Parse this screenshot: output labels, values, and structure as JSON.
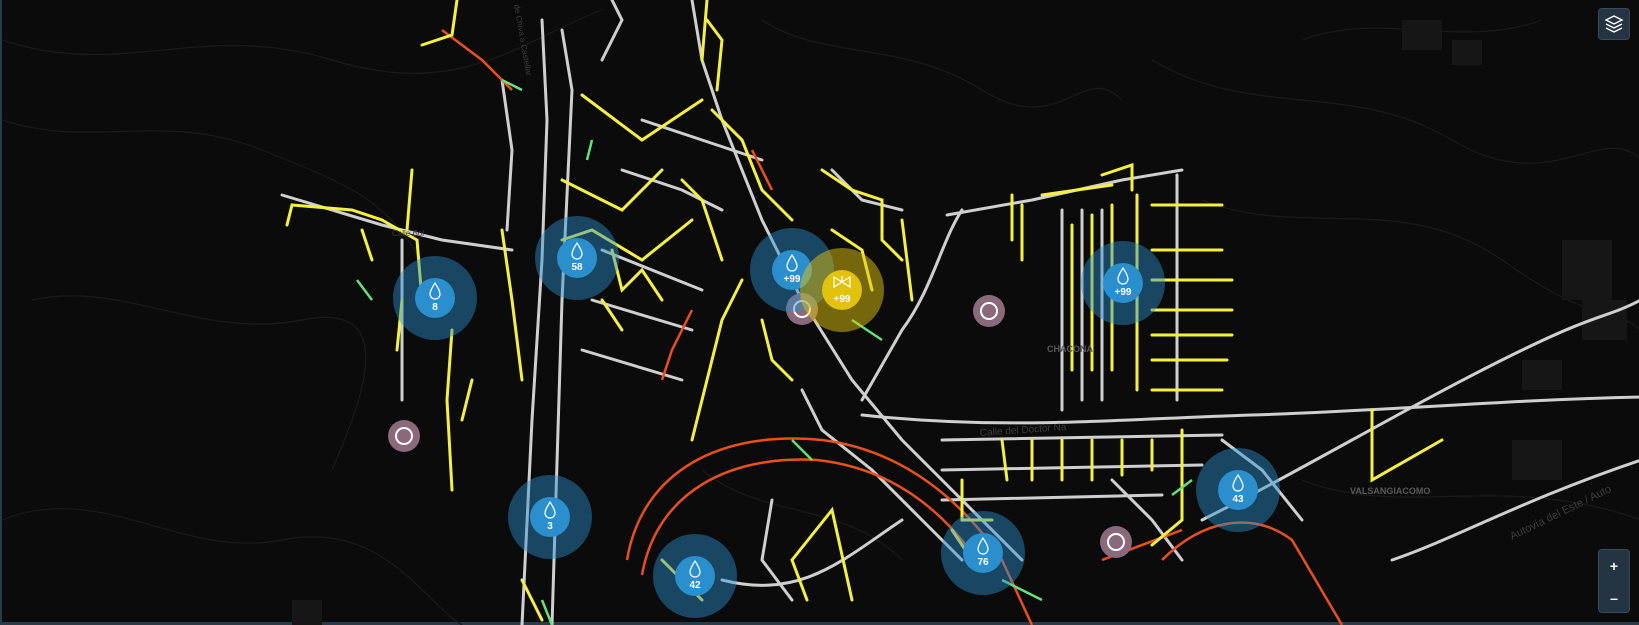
{
  "map": {
    "place_labels": [
      "CHACONA",
      "VALSANGIACOMO"
    ],
    "street_labels": [
      "Calle del Doctor Na",
      "Autovía del Este / Auto",
      "Calle Bol",
      "de Chiva a Castellar"
    ],
    "colors": {
      "background": "#0b0b0b",
      "road": "#d9d9d9",
      "pipe_primary": "#f4f043",
      "pipe_secondary": "#66e07a",
      "pipe_main": "#e8501c",
      "cluster_blue": "#2a8fcc",
      "cluster_yellow": "#e1c20d",
      "marker_pink": "#8a6a7a"
    }
  },
  "clusters": [
    {
      "id": "c1",
      "label": "8",
      "type": "water",
      "color": "blue"
    },
    {
      "id": "c2",
      "label": "58",
      "type": "water",
      "color": "blue"
    },
    {
      "id": "c3",
      "label": "+99",
      "type": "water",
      "color": "blue"
    },
    {
      "id": "c4",
      "label": "+99",
      "type": "valve",
      "color": "yellow"
    },
    {
      "id": "c5",
      "label": "+99",
      "type": "water",
      "color": "blue"
    },
    {
      "id": "c6",
      "label": "3",
      "type": "water",
      "color": "blue"
    },
    {
      "id": "c7",
      "label": "42",
      "type": "water",
      "color": "blue"
    },
    {
      "id": "c8",
      "label": "76",
      "type": "water",
      "color": "blue"
    },
    {
      "id": "c9",
      "label": "43",
      "type": "water",
      "color": "blue"
    }
  ],
  "controls": {
    "layers_icon": "layers-icon",
    "zoom_in": "+",
    "zoom_out": "–"
  }
}
